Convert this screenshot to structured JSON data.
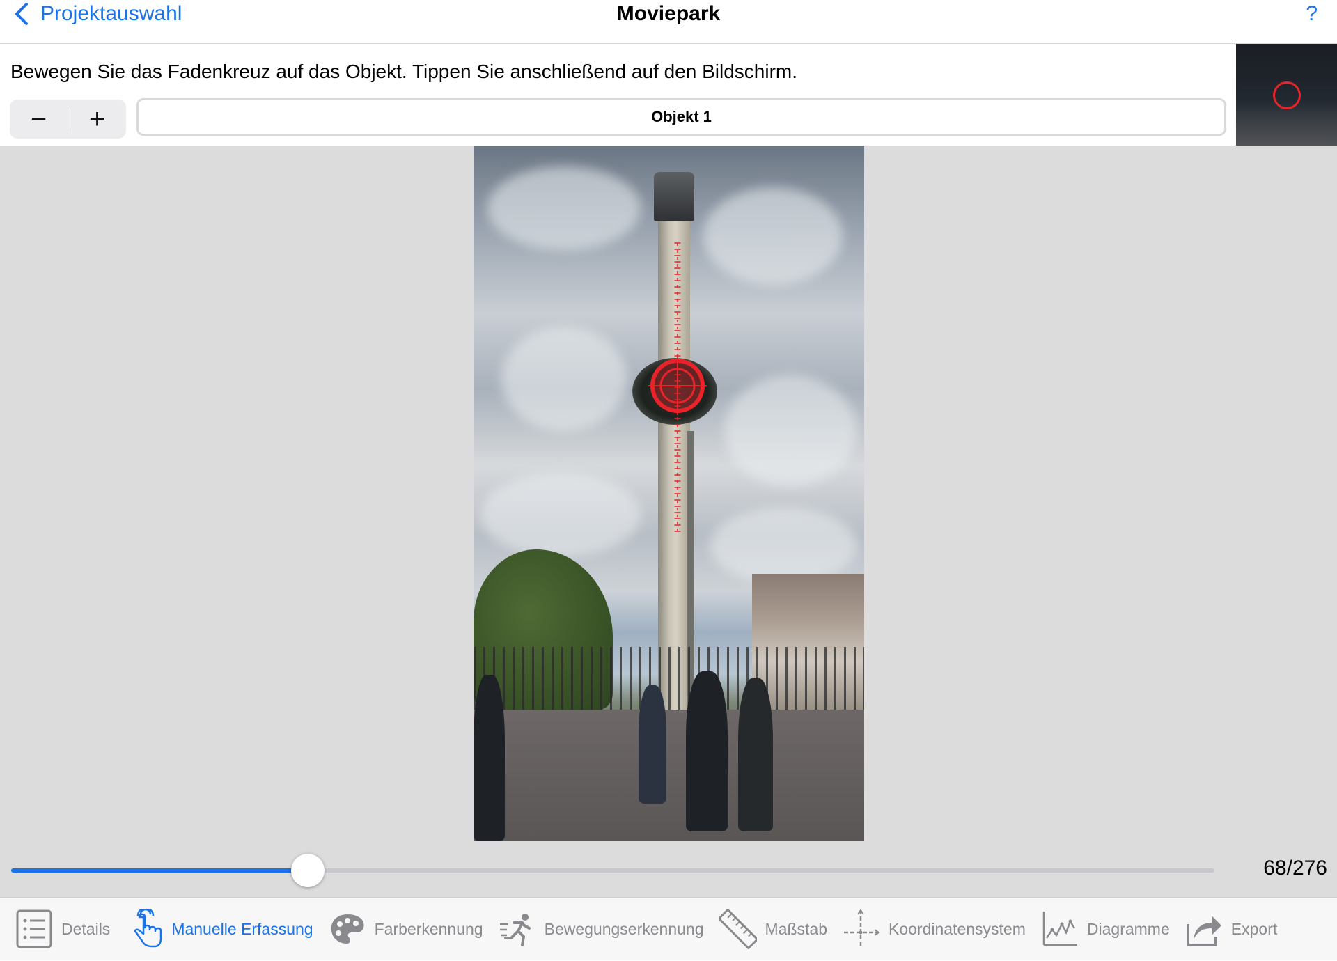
{
  "nav": {
    "back_label": "Projektauswahl",
    "title": "Moviepark",
    "help_label": "?"
  },
  "instruction": "Bewegen Sie das Fadenkreuz auf das Objekt. Tippen Sie anschließend auf den Bildschirm.",
  "stepper": {
    "minus": "−",
    "plus": "+"
  },
  "object_field": "Objekt 1",
  "timeline": {
    "current_frame": 68,
    "total_frames": 276,
    "counter_label": "68/276"
  },
  "tabs": [
    {
      "label": "Details",
      "icon": "list-icon",
      "active": false
    },
    {
      "label": "Manuelle Erfassung",
      "icon": "hand-tap-icon",
      "active": true
    },
    {
      "label": "Farberkennung",
      "icon": "palette-icon",
      "active": false
    },
    {
      "label": "Bewegungserkennung",
      "icon": "running-icon",
      "active": false
    },
    {
      "label": "Maßstab",
      "icon": "ruler-icon",
      "active": false
    },
    {
      "label": "Koordinatensystem",
      "icon": "axes-icon",
      "active": false
    },
    {
      "label": "Diagramme",
      "icon": "chart-icon",
      "active": false
    },
    {
      "label": "Export",
      "icon": "share-icon",
      "active": false
    }
  ],
  "colors": {
    "accent": "#1a73e8",
    "marker": "#e8232a",
    "inactive_tab": "#8a8a8e"
  }
}
